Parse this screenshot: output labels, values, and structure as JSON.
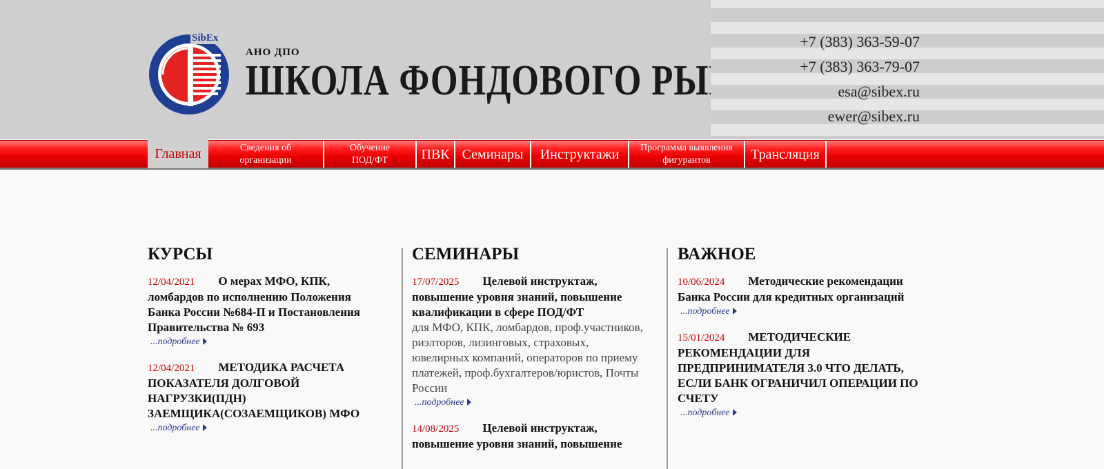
{
  "header": {
    "logo_badge": "SibEx",
    "subtitle": "АНО ДПО",
    "title": "ШКОЛА ФОНДОВОГО РЫНКА",
    "contacts": [
      "+7 (383) 363-59-07",
      "+7 (383) 363-79-07",
      "esa@sibex.ru",
      "ewer@sibex.ru"
    ]
  },
  "nav": {
    "items": [
      "Главная",
      "Сведения об организации",
      "Обучение ПОД/ФТ",
      "ПВК",
      "Семинары",
      "Инструктажи",
      "Программа выявления фигурантов",
      "Трансляция"
    ],
    "active": "Главная"
  },
  "more_label": "...подробнее",
  "columns": {
    "courses": {
      "title": "КУРСЫ",
      "items": [
        {
          "date": "12/04/2021",
          "title": "О мерах МФО, КПК, ломбардов по исполнению Положения Банка России №684-П и Постановления Правительства № 693"
        },
        {
          "date": "12/04/2021",
          "title": "МЕТОДИКА РАСЧЕТА ПОКАЗАТЕЛЯ ДОЛГОВОЙ НАГРУЗКИ(ПДН) ЗАЕМЩИКА(СОЗАЕМЩИКОВ)  МФО"
        }
      ]
    },
    "seminars": {
      "title": "СЕМИНАРЫ",
      "items": [
        {
          "date": "17/07/2025",
          "title": "Целевой инструктаж, повышение уровня знаний, повышение квалификации в сфере ПОД/ФТ",
          "desc": "для МФО, КПК, ломбардов, проф.участников, риэлторов, лизинговых, страховых, ювелирных компаний, операторов по приему платежей, проф.бухгалтеров/юристов, Почты России"
        },
        {
          "date": "14/08/2025",
          "title": "Целевой инструктаж, повышение уровня знаний, повышение"
        }
      ]
    },
    "important": {
      "title": "ВАЖНОЕ",
      "items": [
        {
          "date": "10/06/2024",
          "title": "Методические рекомендации Банка России для кредитных организаций"
        },
        {
          "date": "15/01/2024",
          "title": "МЕТОДИЧЕСКИЕ РЕКОМЕНДАЦИИ ДЛЯ ПРЕДПРИНИМАТЕЛЯ 3.0 ЧТО ДЕЛАТЬ, ЕСЛИ БАНК ОГРАНИЧИЛ ОПЕРАЦИИ ПО СЧЕТУ"
        }
      ]
    }
  },
  "colors": {
    "nav_red": "#e80000",
    "date_red": "#c00000",
    "link_blue": "#2a3a8a",
    "header_gray": "#cfcfcf"
  }
}
